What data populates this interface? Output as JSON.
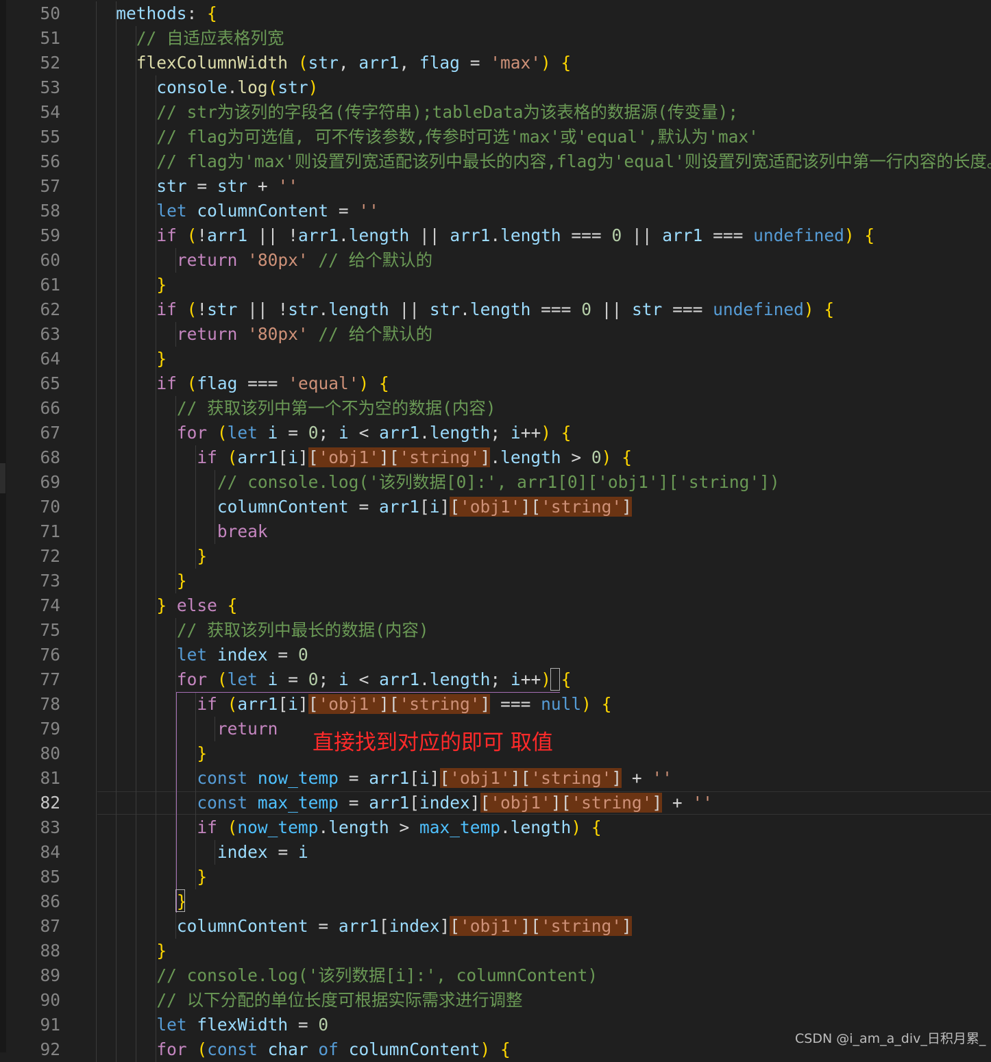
{
  "editor": {
    "theme_colors": {
      "background": "#1f1f1f",
      "keyword": "#c586c0",
      "string": "#ce9178",
      "comment": "#6a9955",
      "highlight": "#6b3413"
    },
    "current_line": "82",
    "lines": [
      {
        "n": "50",
        "t": "    methods: {"
      },
      {
        "n": "51",
        "t": "      // 自适应表格列宽"
      },
      {
        "n": "52",
        "t": "      flexColumnWidth (str, arr1, flag = 'max') {"
      },
      {
        "n": "53",
        "t": "        console.log(str)"
      },
      {
        "n": "54",
        "t": "        // str为该列的字段名(传字符串);tableData为该表格的数据源(传变量);"
      },
      {
        "n": "55",
        "t": "        // flag为可选值, 可不传该参数,传参时可选'max'或'equal',默认为'max'"
      },
      {
        "n": "56",
        "t": "        // flag为'max'则设置列宽适配该列中最长的内容,flag为'equal'则设置列宽适配该列中第一行内容的长度。"
      },
      {
        "n": "57",
        "t": "        str = str + ''"
      },
      {
        "n": "58",
        "t": "        let columnContent = ''"
      },
      {
        "n": "59",
        "t": "        if (!arr1 || !arr1.length || arr1.length === 0 || arr1 === undefined) {"
      },
      {
        "n": "60",
        "t": "          return '80px' // 给个默认的"
      },
      {
        "n": "61",
        "t": "        }"
      },
      {
        "n": "62",
        "t": "        if (!str || !str.length || str.length === 0 || str === undefined) {"
      },
      {
        "n": "63",
        "t": "          return '80px' // 给个默认的"
      },
      {
        "n": "64",
        "t": "        }"
      },
      {
        "n": "65",
        "t": "        if (flag === 'equal') {"
      },
      {
        "n": "66",
        "t": "          // 获取该列中第一个不为空的数据(内容)"
      },
      {
        "n": "67",
        "t": "          for (let i = 0; i < arr1.length; i++) {"
      },
      {
        "n": "68",
        "t": "            if (arr1[i]['obj1']['string'].length > 0) {"
      },
      {
        "n": "69",
        "t": "              // console.log('该列数据[0]:', arr1[0]['obj1']['string'])"
      },
      {
        "n": "70",
        "t": "              columnContent = arr1[i]['obj1']['string']"
      },
      {
        "n": "71",
        "t": "              break"
      },
      {
        "n": "72",
        "t": "            }"
      },
      {
        "n": "73",
        "t": "          }"
      },
      {
        "n": "74",
        "t": "        } else {"
      },
      {
        "n": "75",
        "t": "          // 获取该列中最长的数据(内容)"
      },
      {
        "n": "76",
        "t": "          let index = 0"
      },
      {
        "n": "77",
        "t": "          for (let i = 0; i < arr1.length; i++) {"
      },
      {
        "n": "78",
        "t": "            if (arr1[i]['obj1']['string'] === null) {"
      },
      {
        "n": "79",
        "t": "              return"
      },
      {
        "n": "80",
        "t": "            }"
      },
      {
        "n": "81",
        "t": "            const now_temp = arr1[i]['obj1']['string'] + ''"
      },
      {
        "n": "82",
        "t": "            const max_temp = arr1[index]['obj1']['string'] + ''"
      },
      {
        "n": "83",
        "t": "            if (now_temp.length > max_temp.length) {"
      },
      {
        "n": "84",
        "t": "              index = i"
      },
      {
        "n": "85",
        "t": "            }"
      },
      {
        "n": "86",
        "t": "          }"
      },
      {
        "n": "87",
        "t": "          columnContent = arr1[index]['obj1']['string']"
      },
      {
        "n": "88",
        "t": "        }"
      },
      {
        "n": "89",
        "t": "        // console.log('该列数据[i]:', columnContent)"
      },
      {
        "n": "90",
        "t": "        // 以下分配的单位长度可根据实际需求进行调整"
      },
      {
        "n": "91",
        "t": "        let flexWidth = 0"
      },
      {
        "n": "92",
        "t": "        for (const char of columnContent) {"
      }
    ]
  },
  "annotation": "直接找到对应的即可 取值",
  "watermark": "CSDN @i_am_a_div_日积月累_"
}
